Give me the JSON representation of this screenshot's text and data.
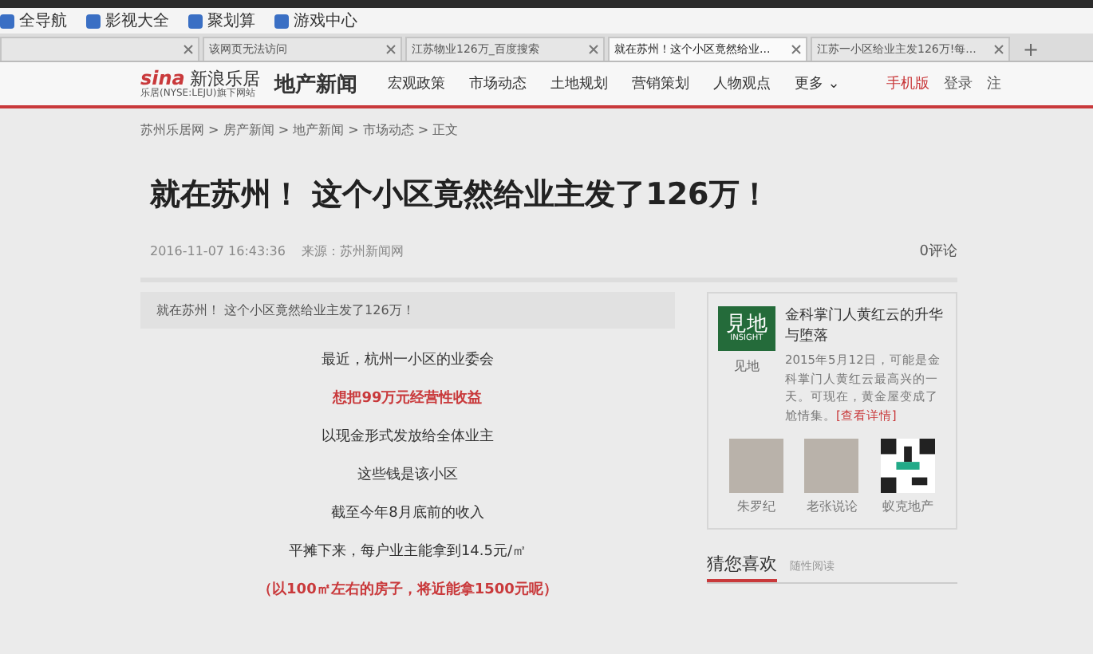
{
  "bookmarks": [
    "全导航",
    "影视大全",
    "聚划算",
    "游戏中心"
  ],
  "tabs": [
    {
      "selected": false
    },
    {
      "label": "该网页无法访问",
      "selected": false
    },
    {
      "label": "江苏物业126万_百度搜索",
      "selected": false
    },
    {
      "label": "就在苏州！这个小区竟然给业...",
      "selected": true
    },
    {
      "label": "江苏一小区给业主发126万!每...",
      "selected": false
    }
  ],
  "new_tab": "+",
  "site": {
    "logo_brand": "sina",
    "logo_name": "新浪乐居",
    "logo_sub": "乐居(NYSE:LEJU)旗下网站",
    "section": "地产新闻",
    "nav": [
      "宏观政策",
      "市场动态",
      "土地规划",
      "营销策划",
      "人物观点",
      "更多 ⌄"
    ],
    "mobile": "手机版",
    "login": "登录",
    "register": "注"
  },
  "breadcrumb": "苏州乐居网 > 房产新闻 > 地产新闻 > 市场动态 > 正文",
  "article": {
    "title": "就在苏州！ 这个小区竟然给业主发了126万！",
    "date": "2016-11-07 16:43:36",
    "source": "来源：苏州新闻网",
    "comments": "0评论",
    "summary": "就在苏州！ 这个小区竟然给业主发了126万！",
    "paragraphs": [
      {
        "text": "最近，杭州一小区的业委会",
        "kind": "plain"
      },
      {
        "text": "想把99万元经营性收益",
        "kind": "highlight"
      },
      {
        "text": "以现金形式发放给全体业主",
        "kind": "plain"
      },
      {
        "text": "这些钱是该小区",
        "kind": "plain"
      },
      {
        "text": "截至今年8月底前的收入",
        "kind": "plain"
      },
      {
        "text": "平摊下来，每户业主能拿到14.5元/㎡",
        "kind": "plain"
      },
      {
        "text": "（以100㎡左右的房子，将近能拿1500元呢）",
        "kind": "highlight"
      }
    ]
  },
  "sidebar": {
    "logo_top": "見地",
    "logo_bottom": "INSIGHT",
    "logo_caption": "见地",
    "headline": "金科掌门人黄红云的升华与堕落",
    "excerpt": "2015年5月12日，可能是金科掌门人黄红云最高兴的一天。可现在，黄金屋变成了尬情集。",
    "more": "[查看详情]",
    "thumbs": [
      {
        "caption": "朱罗纪",
        "kind": "portrait"
      },
      {
        "caption": "老张说论",
        "kind": "portrait"
      },
      {
        "caption": "蚁克地产",
        "kind": "qr"
      }
    ],
    "tab": "猜您喜欢",
    "tab_hint": "随性阅读"
  }
}
